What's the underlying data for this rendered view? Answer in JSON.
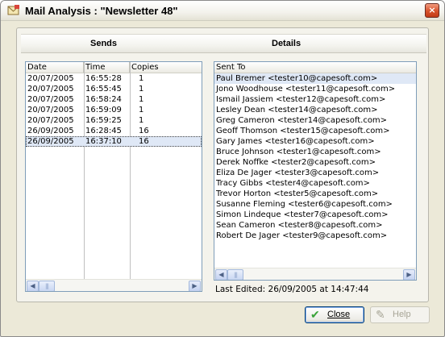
{
  "window": {
    "title": "Mail Analysis : \"Newsletter 48\""
  },
  "colors": {
    "selection": "#dfe8f6",
    "accent": "#316ac5",
    "close": "#d6512b",
    "check": "#3aa33a"
  },
  "sends": {
    "heading": "Sends",
    "columns": [
      "Date",
      "Time",
      "Copies"
    ],
    "rows": [
      {
        "date": "20/07/2005",
        "time": "16:55:28",
        "copies": "1"
      },
      {
        "date": "20/07/2005",
        "time": "16:55:45",
        "copies": "1"
      },
      {
        "date": "20/07/2005",
        "time": "16:58:24",
        "copies": "1"
      },
      {
        "date": "20/07/2005",
        "time": "16:59:09",
        "copies": "1"
      },
      {
        "date": "20/07/2005",
        "time": "16:59:25",
        "copies": "1"
      },
      {
        "date": "26/09/2005",
        "time": "16:28:45",
        "copies": "16"
      },
      {
        "date": "26/09/2005",
        "time": "16:37:10",
        "copies": "16"
      }
    ],
    "selected_row": 6
  },
  "details": {
    "heading": "Details",
    "column": "Sent To",
    "rows": [
      "Paul Bremer <tester10@capesoft.com>",
      "Jono Woodhouse <tester11@capesoft.com>",
      "Ismail Jassiem <tester12@capesoft.com>",
      "Lesley Dean <tester14@capesoft.com>",
      "Greg Cameron <tester14@capesoft.com>",
      "Geoff Thomson <tester15@capesoft.com>",
      "Gary James <tester16@capesoft.com>",
      "Bruce Johnson <tester1@capesoft.com>",
      "Derek Noffke <tester2@capesoft.com>",
      "Eliza De Jager <tester3@capesoft.com>",
      "Tracy Gibbs <tester4@capesoft.com>",
      "Trevor Horton <tester5@capesoft.com>",
      "Susanne Fleming <tester6@capesoft.com>",
      "Simon Lindeque <tester7@capesoft.com>",
      "Sean Cameron <tester8@capesoft.com>",
      "Robert De Jager <tester9@capesoft.com>"
    ],
    "selected_row": 0,
    "last_edited": "Last Edited: 26/09/2005 at 14:47:44"
  },
  "buttons": {
    "close": "Close",
    "help": "Help"
  },
  "icons": {
    "close": "×",
    "check": "✔",
    "help": "✎",
    "left": "◀",
    "right": "▶",
    "grip": "|||"
  }
}
